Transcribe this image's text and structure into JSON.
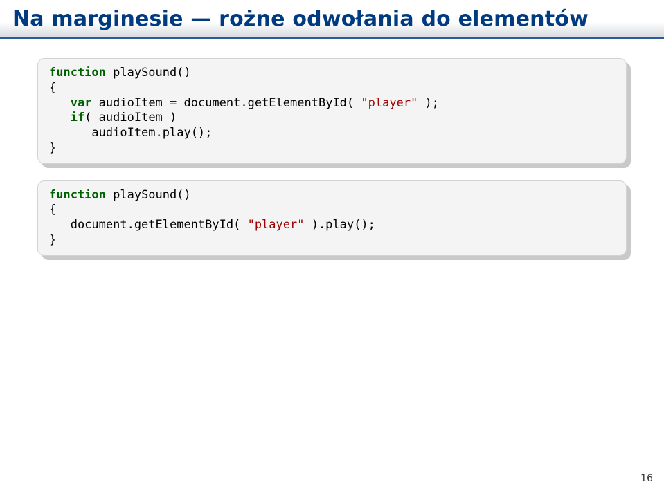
{
  "slide": {
    "title": "Na marginesie — rożne odwołania do elementów",
    "page_number": "16"
  },
  "code1": {
    "l1a": "function",
    "l1b": " playSound()",
    "l2": "{",
    "l3a": "   ",
    "l3b": "var",
    "l3c": " audioItem = document.getElementById( ",
    "l3d": "\"player\"",
    "l3e": " );",
    "l4a": "   ",
    "l4b": "if",
    "l4c": "( audioItem )",
    "l5": "      audioItem.play();",
    "l6": "}"
  },
  "code2": {
    "l1a": "function",
    "l1b": " playSound()",
    "l2": "{",
    "l3a": "   document.getElementById( ",
    "l3b": "\"player\"",
    "l3c": " ).play();",
    "l4": "}"
  }
}
